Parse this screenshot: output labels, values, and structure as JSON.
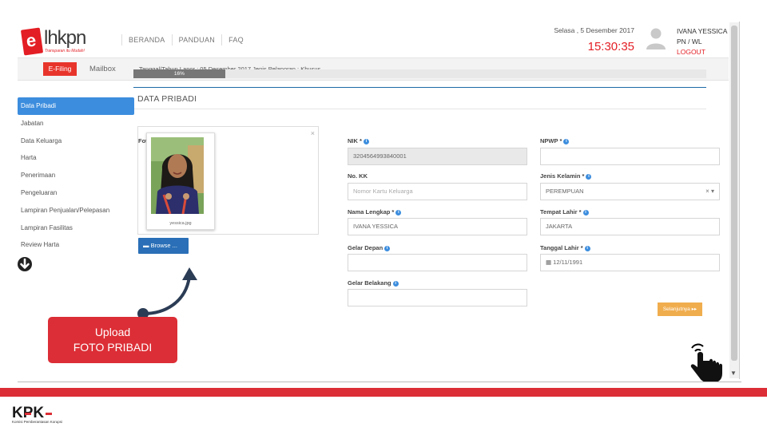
{
  "header": {
    "logo_text": "lhkpn",
    "logo_letter": "e",
    "logo_tagline": "Transparan itu Mudah!",
    "nav": [
      "BERANDA",
      "PANDUAN",
      "FAQ"
    ],
    "date": "Selasa , 5 Desember 2017",
    "time": "15:30:35",
    "user_name": "IVANA YESSICA",
    "user_role": "PN / WL",
    "logout_label": "LOGOUT"
  },
  "subbar": {
    "efiling_label": "E-Filing",
    "mailbox_label": "Mailbox",
    "report_info": "Tanggal/Tahun Lapor : 05 Desember 2017   Jenis Pelaporan : Khusus"
  },
  "progress": {
    "percent": 16,
    "label": "16%"
  },
  "section": {
    "title": "DATA PRIBADI"
  },
  "sidemenu": {
    "items": [
      "Data Pribadi",
      "Jabatan",
      "Data Keluarga",
      "Harta",
      "Penerimaan",
      "Pengeluaran",
      "Lampiran Penjualan/Pelepasan",
      "Lampiran Fasilitas",
      "Review Harta"
    ],
    "active_index": 0
  },
  "form": {
    "foto_label": "Foto",
    "photo_caption": "yessica.jpg",
    "browse_label": "Browse ...",
    "nik_label": "NIK *",
    "nik_value": "3204564993840001",
    "npwp_label": "NPWP *",
    "npwp_value": "",
    "nokk_label": "No. KK",
    "nokk_placeholder": "Nomor Kartu Keluarga",
    "gender_label": "Jenis Kelamin *",
    "gender_value": "PEREMPUAN",
    "nama_label": "Nama Lengkap *",
    "nama_value": "IVANA YESSICA",
    "tempat_label": "Tempat Lahir *",
    "tempat_value": "JAKARTA",
    "gelar_depan_label": "Gelar Depan",
    "gelar_depan_value": "",
    "tanggal_label": "Tanggal Lahir *",
    "tanggal_value": "12/11/1991",
    "gelar_belakang_label": "Gelar Belakang",
    "gelar_belakang_value": "",
    "next_label": "Selanjutnya"
  },
  "annotation": {
    "line1": "Upload",
    "line2": "FOTO PRIBADI"
  },
  "footer": {
    "kpk_logo": "KPK",
    "kpk_sub": "Komisi Pemberantasan Korupsi"
  },
  "colors": {
    "brand_red": "#e31e24",
    "active_blue": "#3c8dde",
    "browse_blue": "#2a6fb7",
    "next_orange": "#f0ad4e"
  }
}
